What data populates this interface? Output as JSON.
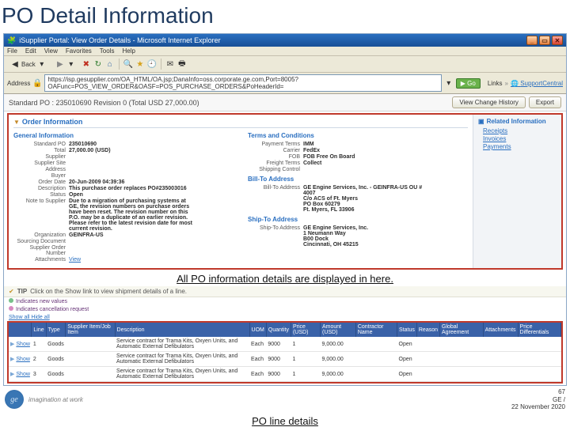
{
  "slide": {
    "title": "PO Detail Information"
  },
  "browser": {
    "title": "iSupplier Portal: View Order Details - Microsoft Internet Explorer",
    "menu": [
      "File",
      "Edit",
      "View",
      "Favorites",
      "Tools",
      "Help"
    ],
    "toolbar": {
      "back": "Back",
      "forward": ""
    },
    "address_label": "Address",
    "url": "https://isp.gesupplier.com/OA_HTML/OA.jsp;DanaInfo=oss.corporate.ge.com,Port=8005?OAFunc=POS_VIEW_ORDER&OASF=POS_PURCHASE_ORDERS&PoHeaderId=",
    "go": "Go",
    "links_label": "Links",
    "support_link": "SupportCentral"
  },
  "po_header": {
    "text": "Standard PO : 235010690 Revision 0 (Total USD 27,000.00)",
    "btn_viewchange": "View Change History",
    "btn_export": "Export"
  },
  "order_info": {
    "section_title": "Order Information",
    "general_heading": "General Information",
    "terms_heading": "Terms and Conditions",
    "billto_heading": "Bill-To Address",
    "shipto_heading": "Ship-To Address",
    "general": {
      "po_l": "Standard PO",
      "po_v": "235010690",
      "total_l": "Total",
      "total_v": "27,000.00 (USD)",
      "supplier_l": "Supplier",
      "supplier_v": "",
      "site_l": "Supplier Site",
      "site_v": "",
      "address_l": "Address",
      "address_v": "",
      "buyer_l": "Buyer",
      "buyer_v": "",
      "orderdate_l": "Order Date",
      "orderdate_v": "20-Jun-2009 04:39:36",
      "desc_l": "Description",
      "desc_v": "This purchase order replaces PO#235003016",
      "status_l": "Status",
      "status_v": "Open",
      "note_l": "Note to Supplier",
      "note_v": "Due to a migration of purchasing systems at GE, the revision numbers on purchase orders have been reset. The revision number on this P.O. may be a duplicate of an earlier revision. Please refer to the latest revision date for most current revision.",
      "org_l": "Organization",
      "org_v": "GEINFRA-US",
      "srcdoc_l": "Sourcing Document",
      "srcdoc_v": "",
      "sordnum_l": "Supplier Order Number",
      "sordnum_v": "",
      "attach_l": "Attachments",
      "attach_v": "View"
    },
    "terms": {
      "payterms_l": "Payment Terms",
      "payterms_v": "IMM",
      "carrier_l": "Carrier",
      "carrier_v": "FedEx",
      "fob_l": "FOB",
      "fob_v": "FOB Free On Board",
      "freight_l": "Freight Terms",
      "freight_v": "Collect",
      "shipctrl_l": "Shipping Control",
      "shipctrl_v": ""
    },
    "billto": {
      "addr_l": "Bill-To Address",
      "addr_v": "GE Engine Services, Inc. - GEINFRA-US OU # 4007\nC/o ACS of Ft. Myers\nPO Box 60279\nFt. Myers, FL 33906"
    },
    "shipto": {
      "addr_l": "Ship-To Address",
      "addr_v": "GE Engine Services, Inc.\n1 Neumann Way\nB00 Dock\nCincinnati, OH 45215"
    }
  },
  "related": {
    "title": "Related Information",
    "links": {
      "receipts": "Receipts",
      "invoices": "Invoices",
      "payments": "Payments"
    }
  },
  "callouts": {
    "c1": "All PO information details are displayed in here.",
    "c2": "PO line details"
  },
  "tip": {
    "text": "Click on the Show link to view shipment details of a line.",
    "label": "TIP"
  },
  "legend": {
    "new": "Indicates new values",
    "cancel": "Indicates cancellation request"
  },
  "showall": "Show all  Hide all",
  "grid": {
    "cols": [
      "",
      "Line",
      "Type",
      "Supplier Item/Job Item",
      "Description",
      "UOM",
      "Quantity",
      "Price (USD)",
      "Amount (USD)",
      "Contractor Name",
      "Status",
      "Reason",
      "Global Agreement",
      "Attachments",
      "Price Differentials"
    ],
    "rows": [
      {
        "show": "Show",
        "line": "1",
        "type": "Goods",
        "desc": "Service contract for Trama Kits, Oxyen Units, and Automatic External Defibulators",
        "uom": "Each",
        "qty": "9000",
        "price": "1",
        "amount": "9,000.00",
        "status": "Open"
      },
      {
        "show": "Show",
        "line": "2",
        "type": "Goods",
        "desc": "Service contract for Trama Kits, Oxyen Units, and Automatic External Defibulators",
        "uom": "Each",
        "qty": "9000",
        "price": "1",
        "amount": "9,000.00",
        "status": "Open"
      },
      {
        "show": "Show",
        "line": "3",
        "type": "Goods",
        "desc": "Service contract for Trama Kits, Oxyen Units, and Automatic External Defibulators",
        "uom": "Each",
        "qty": "9000",
        "price": "1",
        "amount": "9,000.00",
        "status": "Open"
      }
    ]
  },
  "footer": {
    "tagline": "imagination at work",
    "page": "67",
    "org": "GE /",
    "date": "22 November 2020"
  }
}
